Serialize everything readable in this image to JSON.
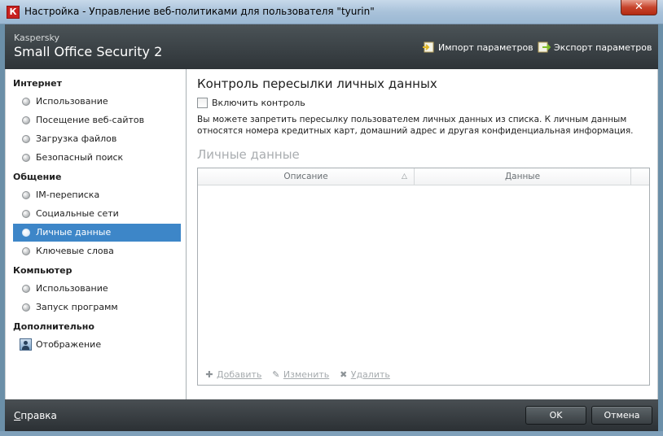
{
  "window": {
    "title": "Настройка - Управление веб-политиками для пользователя \"tyurin\"",
    "app_icon": "К",
    "close_label": "✕"
  },
  "header": {
    "brand_small": "Kaspersky",
    "brand_big": "Small Office Security 2",
    "import_label": "Импорт параметров",
    "export_label": "Экспорт параметров"
  },
  "sidebar": {
    "groups": [
      {
        "title": "Интернет",
        "items": [
          "Использование",
          "Посещение веб-сайтов",
          "Загрузка файлов",
          "Безопасный поиск"
        ]
      },
      {
        "title": "Общение",
        "items": [
          "IM-переписка",
          "Социальные сети",
          "Личные данные",
          "Ключевые слова"
        ]
      },
      {
        "title": "Компьютер",
        "items": [
          "Использование",
          "Запуск программ"
        ]
      },
      {
        "title": "Дополнительно",
        "items": [
          "Отображение"
        ]
      }
    ],
    "active_item": "Личные данные"
  },
  "content": {
    "page_title": "Контроль пересылки личных данных",
    "enable_label": "Включить контроль",
    "enable_checked": false,
    "description": "Вы можете запретить пересылку пользователем личных данных из списка. К личным данным относятся номера кредитных карт, домашний адрес и другая конфиденциальная информация.",
    "section_title": "Личные данные",
    "table": {
      "columns": [
        "Описание",
        "Данные"
      ],
      "sort_icon": "△",
      "rows": [],
      "actions": {
        "add": {
          "glyph": "✚",
          "label": "Добавить"
        },
        "edit": {
          "glyph": "✎",
          "label": "Изменить"
        },
        "delete": {
          "glyph": "✖",
          "label": "Удалить"
        }
      }
    }
  },
  "footer": {
    "help_label": "Справка",
    "ok_label": "OK",
    "cancel_label": "Отмена"
  },
  "colors": {
    "accent": "#3d86c8",
    "header_bg": "#2e3438",
    "disabled_text": "#a6abae"
  }
}
